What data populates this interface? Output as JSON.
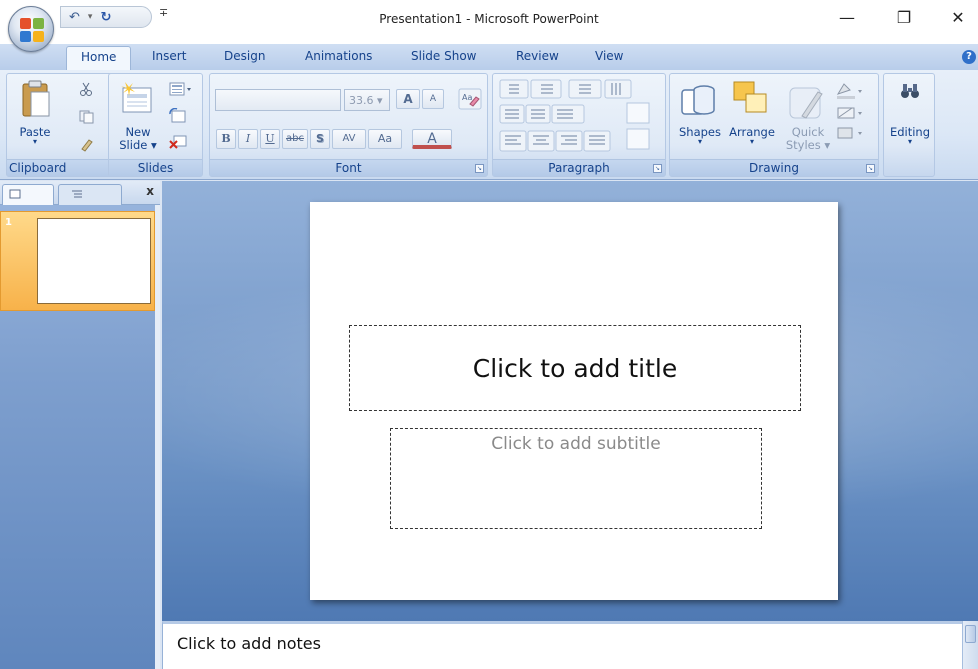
{
  "window": {
    "title": "Presentation1 - Microsoft PowerPoint",
    "minimize_glyph": "—",
    "restore_glyph": "❐",
    "close_glyph": "✕"
  },
  "quick_access": {
    "undo_glyph": "↶",
    "undo_dropdown_glyph": "▾",
    "redo_glyph": "↻",
    "customize_glyph": "∓"
  },
  "tabs": [
    "Home",
    "Insert",
    "Design",
    "Animations",
    "Slide Show",
    "Review",
    "View"
  ],
  "help_glyph": "?",
  "ribbon": {
    "clipboard": {
      "label": "Clipboard",
      "paste": "Paste",
      "paste_arrow": "▾"
    },
    "slides": {
      "label": "Slides",
      "new_slide_line1": "New",
      "new_slide_line2": "Slide ▾"
    },
    "font": {
      "label": "Font",
      "font_size": "33.6 ▾",
      "grow_font": "A",
      "shrink_font": "A",
      "bold": "B",
      "italic": "I",
      "underline": "U",
      "strikethrough": "abc",
      "shadow": "S",
      "char_spacing": "AV",
      "change_case": "Aa",
      "font_color": "A"
    },
    "paragraph": {
      "label": "Paragraph"
    },
    "drawing": {
      "label": "Drawing",
      "shapes": "Shapes",
      "shapes_arrow": "▾",
      "arrange": "Arrange",
      "arrange_arrow": "▾",
      "quick_styles_line1": "Quick",
      "quick_styles_line2": "Styles ▾"
    },
    "editing": {
      "label": "Editing",
      "arrow": "▾"
    }
  },
  "slides_pane": {
    "close_glyph": "x",
    "slide_number": "1"
  },
  "slide": {
    "title_placeholder": "Click to add title",
    "subtitle_placeholder": "Click to add subtitle"
  },
  "notes": {
    "placeholder": "Click to add notes"
  },
  "colors": {
    "ribbon_text": "#15428b",
    "workspace_blue": "#6a91c4",
    "selected_thumb": "#f7b24a"
  }
}
